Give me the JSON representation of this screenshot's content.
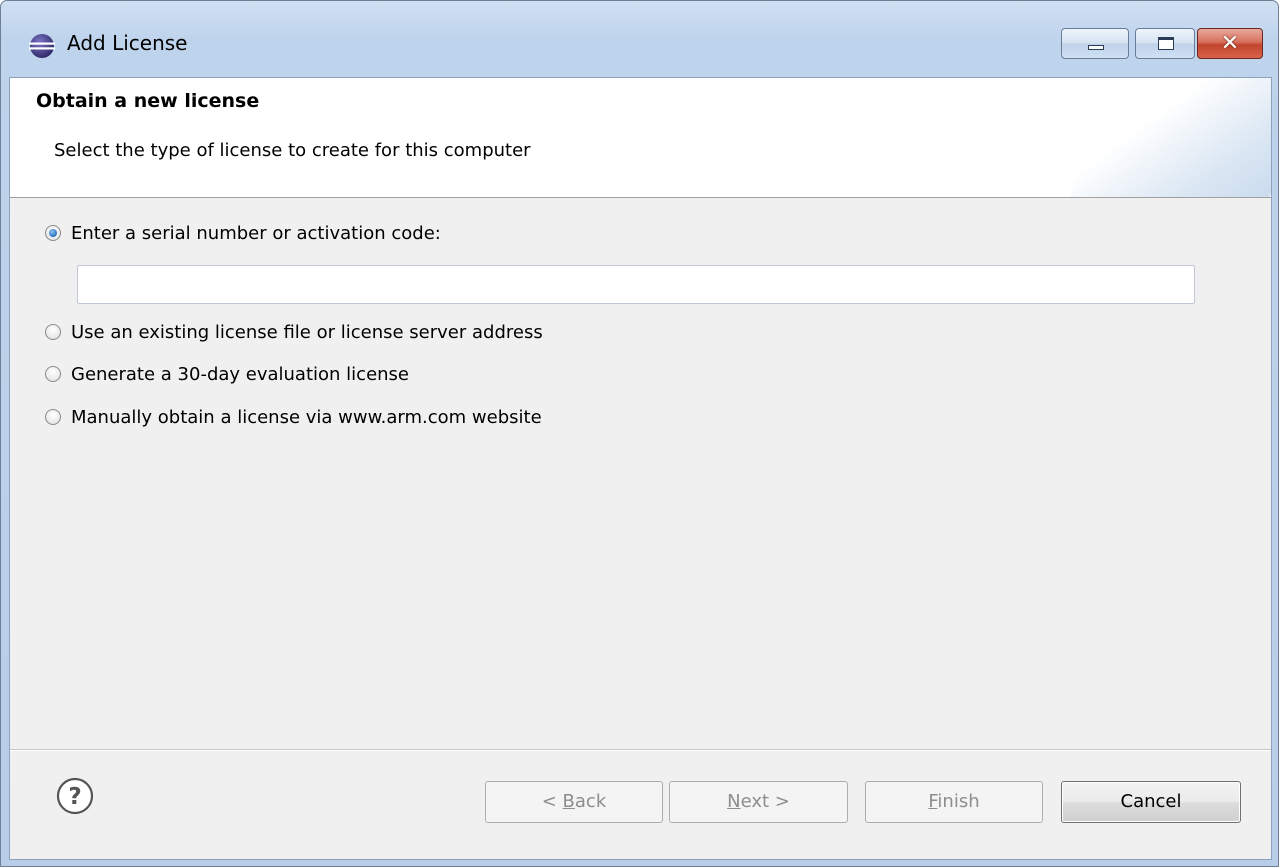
{
  "window": {
    "title": "Add License",
    "app_icon": "eclipse-icon"
  },
  "banner": {
    "title": "Obtain a new license",
    "subtitle": "Select the type of license to create for this computer"
  },
  "options": [
    {
      "label": "Enter a serial number or activation code:",
      "checked": true
    },
    {
      "label": "Use an existing license file or license server address",
      "checked": false
    },
    {
      "label": "Generate a 30-day evaluation license",
      "checked": false
    },
    {
      "label": "Manually obtain a license via www.arm.com website",
      "checked": false
    }
  ],
  "serial_input": {
    "value": "",
    "placeholder": ""
  },
  "buttons": {
    "back": {
      "prefix": "< ",
      "mnemonic": "B",
      "rest": "ack",
      "enabled": false
    },
    "next": {
      "prefix": "",
      "mnemonic": "N",
      "rest": "ext >",
      "enabled": false
    },
    "finish": {
      "prefix": "",
      "mnemonic": "F",
      "rest": "inish",
      "enabled": false
    },
    "cancel": {
      "label": "Cancel",
      "enabled": true
    }
  },
  "icons": {
    "help": "help-icon",
    "minimize": "minimize-icon",
    "maximize": "maximize-icon",
    "close": "close-icon"
  }
}
